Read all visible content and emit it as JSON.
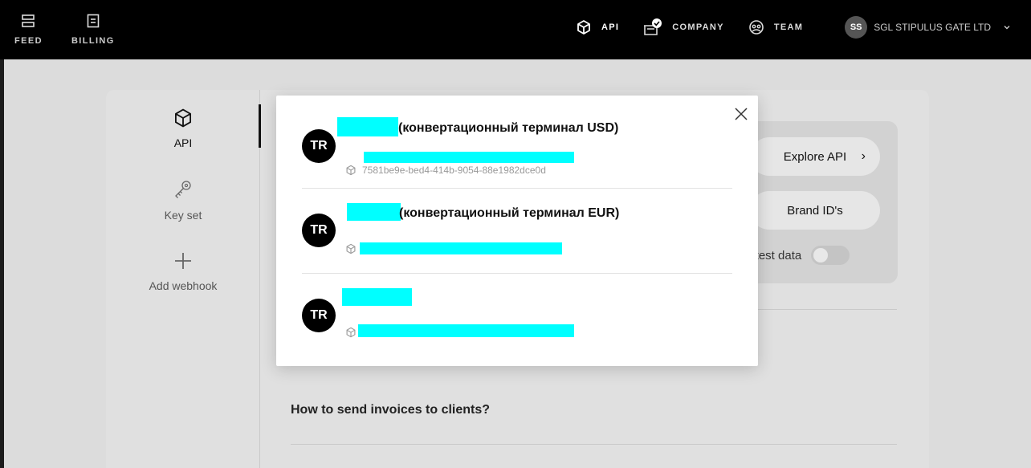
{
  "topbar": {
    "left": [
      {
        "label": "FEED",
        "icon": "feed-icon"
      },
      {
        "label": "BILLING",
        "icon": "billing-icon"
      }
    ],
    "right": {
      "api": "API",
      "company": "COMPANY",
      "team": "TEAM",
      "avatar_initials": "SS",
      "company_name": "SGL STIPULUS GATE LTD"
    }
  },
  "sidebar": {
    "items": [
      {
        "label": "API",
        "icon": "cube-icon"
      },
      {
        "label": "Key set",
        "icon": "key-icon"
      },
      {
        "label": "Add webhook",
        "icon": "plus-icon"
      }
    ]
  },
  "panel": {
    "explore_api": "Explore API",
    "brand_ids": "Brand ID's",
    "test_data_label": "v test data"
  },
  "faq": {
    "question": "How to send invoices to clients?"
  },
  "modal": {
    "terminals": [
      {
        "initials": "TR",
        "name_suffix": "(конвертационный терминал USD)",
        "id_visible": "7581be9e-bed4-414b-9054-88e1982dce0d"
      },
      {
        "initials": "TR",
        "name_suffix": "(конвертационный терминал EUR)",
        "id_visible": ""
      },
      {
        "initials": "TR",
        "name_suffix": "",
        "id_visible": ""
      }
    ]
  },
  "colors": {
    "topbar_bg": "#000000",
    "redaction": "#00ffff",
    "backdrop": "#dcdcdc",
    "modal_bg": "#ffffff"
  }
}
